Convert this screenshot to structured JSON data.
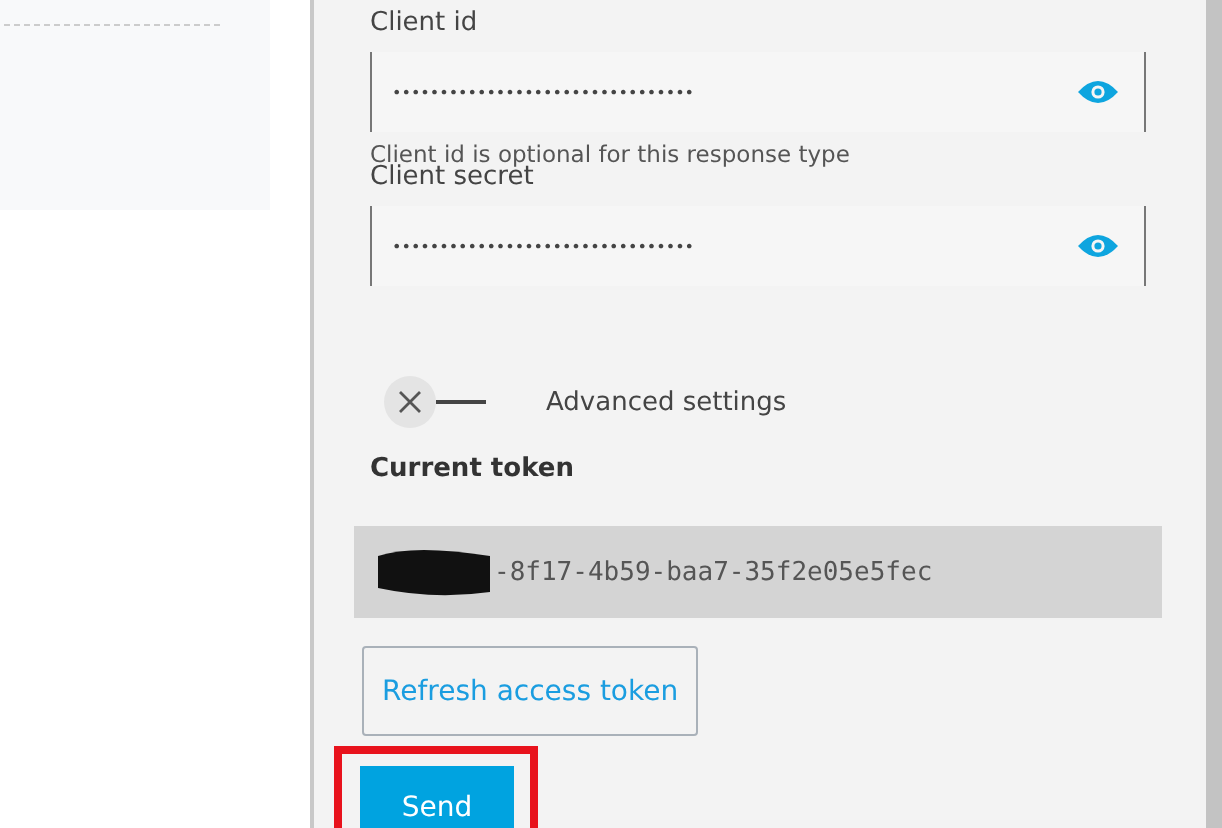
{
  "fields": [
    {
      "label": "Client id",
      "value": "••••••••••••••••••••••••••••••••",
      "hint": "Client id is optional for this response type"
    },
    {
      "label": "Client secret",
      "value": "••••••••••••••••••••••••••••••••"
    }
  ],
  "advanced_toggle": {
    "label": "Advanced settings",
    "on": false
  },
  "current_token": {
    "label": "Current token",
    "value": "-8f17-4b59-baa7-35f2e05e5fec"
  },
  "buttons": [
    {
      "label": "Refresh access token",
      "kind": "outline"
    },
    {
      "label": "Send",
      "kind": "primary",
      "highlighted": true
    }
  ]
}
